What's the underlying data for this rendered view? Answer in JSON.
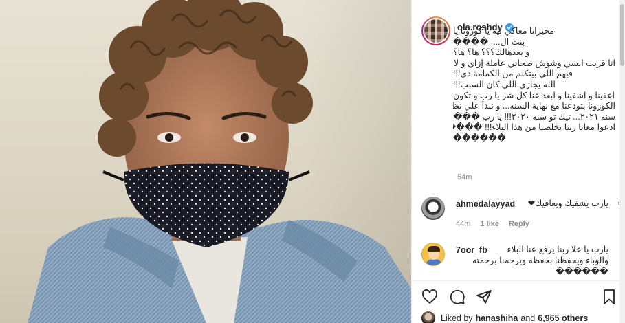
{
  "post": {
    "username": "ola.roshdy",
    "caption_lines": [
      "محيرانا معاكي ليه يا كورونا يا",
      "بنت ال.... ����",
      "و بعدهالك؟؟؟ ها؟ ها؟",
      "انا قربت انسي وشوش صحابي عاملة إزاي و لا مين",
      "فيهم اللي بيتكلم من الكمامة دي!!!",
      "الله يجازي اللي كان السبب!!!",
      "اعفينا و اشفينا و ابعد عنا كل شر يا رب و تكون",
      "الكورونا بتودعنا مع نهاية السنه... و نبدأ علي نظافة",
      "سنه ٢٠٢١... تيك تو سنه ٢٠٢٠!!! يا رب ����",
      "ادعوا معانا ربنا يخلصنا من هذا البلاء!!! ������",
      "������"
    ],
    "time_ago": "54m"
  },
  "comments": [
    {
      "username": "ahmedalayyad",
      "text": "يارب يشفيك ويعافيك❤",
      "time": "44m",
      "likes": "1 like",
      "reply_label": "Reply"
    },
    {
      "username": "7oor_fb",
      "text_lines": [
        "يارب يا علا ربنا يرفع عنا البلاء",
        "والوباء ويحفظنا بحفظه ويرحمنا برحمته",
        "������"
      ]
    }
  ],
  "likes_bar": {
    "liked_by_prefix": "Liked by",
    "liked_by_user": "hanashiha",
    "and_label": "and",
    "others_count": "6,965 others"
  },
  "icons": [
    "heart-icon",
    "comment-icon",
    "share-icon",
    "bookmark-icon",
    "verified-badge-icon"
  ],
  "colors": {
    "verified": "#3897f0",
    "muted": "#8e8e8e",
    "text": "#262626",
    "like_heart": "#262626"
  }
}
